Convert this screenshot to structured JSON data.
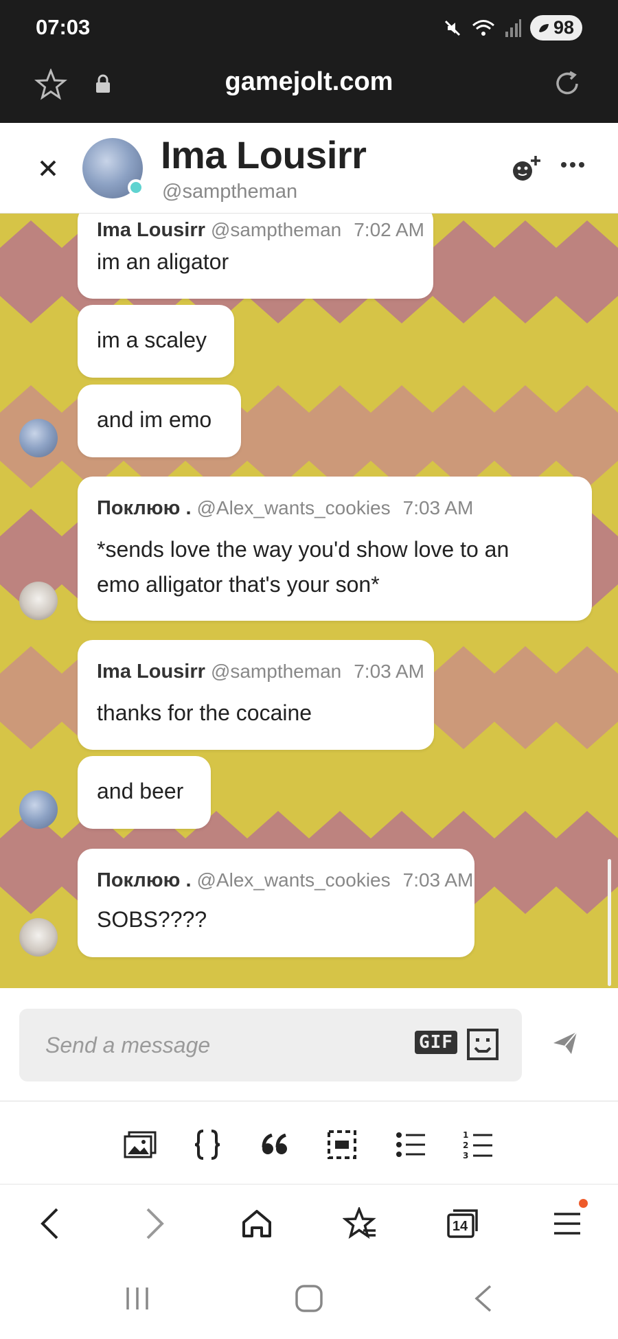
{
  "status_bar": {
    "time": "07:03",
    "battery": "98"
  },
  "browser": {
    "url": "gamejolt.com",
    "tab_count": "14"
  },
  "chat_header": {
    "name": "Ima Lousirr",
    "handle": "@samptheman"
  },
  "messages": [
    {
      "author": "Ima Lousirr",
      "handle": "@samptheman",
      "time": "7:02 AM",
      "lines": [
        "im an aligator"
      ]
    },
    {
      "lines": [
        "im a scaley"
      ]
    },
    {
      "lines": [
        "and im emo"
      ]
    },
    {
      "author": "Поклюю .",
      "handle": "@Alex_wants_cookies",
      "time": "7:03 AM",
      "lines": [
        "*sends love the way you'd show love to an",
        "emo alligator that's your son*"
      ]
    },
    {
      "author": "Ima Lousirr",
      "handle": "@samptheman",
      "time": "7:03 AM",
      "lines": [
        "thanks for the cocaine"
      ]
    },
    {
      "lines": [
        "and beer"
      ]
    },
    {
      "author": "Поклюю .",
      "handle": "@Alex_wants_cookies",
      "time": "7:03 AM",
      "lines": [
        "SOBS????"
      ]
    }
  ],
  "composer": {
    "placeholder": "Send a message",
    "gif_label": "GIF"
  },
  "colors": {
    "chat_bg_yellow": "#d6c447",
    "chat_bg_pink": "#b8788a",
    "online": "#5fd3d0",
    "notification": "#ee5b2b"
  }
}
